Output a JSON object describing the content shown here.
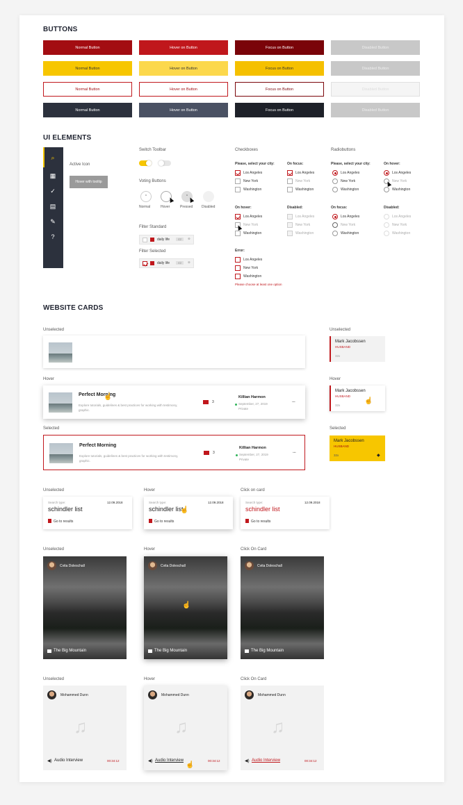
{
  "sections": {
    "buttons": "BUTTONS",
    "ui": "UI ELEMENTS",
    "cards": "WEBSITE CARDS"
  },
  "buttons": {
    "rows": [
      [
        "Normal Button",
        "Hover on Button",
        "Focus on Button",
        "Disabled Button"
      ],
      [
        "Normal Button",
        "Hover on Button",
        "Focus on Button",
        "Disabled Button"
      ],
      [
        "Normal Button",
        "Hover on Button",
        "Focus on Button",
        "Disabled Button"
      ],
      [
        "Normal Button",
        "Hover on Button",
        "Focus on Button",
        "Disabled Button"
      ]
    ],
    "colors": {
      "red": "#a30d12",
      "red_hover": "#c0171c",
      "red_focus": "#7a0409",
      "yellow": "#f7c600",
      "yellow_hover": "#fcd84c",
      "yellow_focus": "#f5c000",
      "dark": "#2c313d",
      "dark_hover": "#4a5163",
      "dark_focus": "#1e2129",
      "disabled": "#c8c8c8"
    }
  },
  "ui": {
    "active_icon": "Active Icon",
    "tooltip": "Hover with tooltip",
    "switch_toolbar": "Switch Toolbar",
    "voting_buttons": "Voting Buttons",
    "voting_states": [
      "Normal",
      "Hover",
      "Pressed",
      "Disabled"
    ],
    "filter_standard": "Filter Standard",
    "filter_selected": "Filter Selected",
    "filter_label": "daily life",
    "filter_count": "42",
    "checkboxes": "Checkboxes",
    "radiobuttons": "Radiobuttons",
    "select_city": "Please, select your city:",
    "on_focus": "On focus:",
    "on_hover": "On hover:",
    "disabled": "Disabled:",
    "error": "Error:",
    "cities": [
      "Los Angeles",
      "New York",
      "Washington"
    ],
    "error_msg": "Please choose at least one option"
  },
  "cards": {
    "unselected": "Unselected",
    "hover": "Hover",
    "selected": "Selected",
    "click_on_card": "Click on card",
    "click_on_card2": "Click On Card",
    "article_title": "Perfect Morning",
    "article_desc": "Explore tutorials, guidelines & best practices for working with testimony, graphic.",
    "comment_count": "3",
    "author": "Killian Harmon",
    "date": "September, 27, 2019",
    "privacy": "Private",
    "more": "•••",
    "person_name": "Mark Jacobssen",
    "person_role": "HUSBAND",
    "person_count": "32x",
    "search_type": "Search type:",
    "search_date": "12.09.2018",
    "search_term": "schindler list",
    "go_results": "Go to results",
    "photo_author": "Cvita Doleschall",
    "photo_title": "The Big Mountain",
    "audio_author": "Mohammed Dunn",
    "audio_title": "Audio Interview",
    "audio_time": "00:34:12"
  }
}
